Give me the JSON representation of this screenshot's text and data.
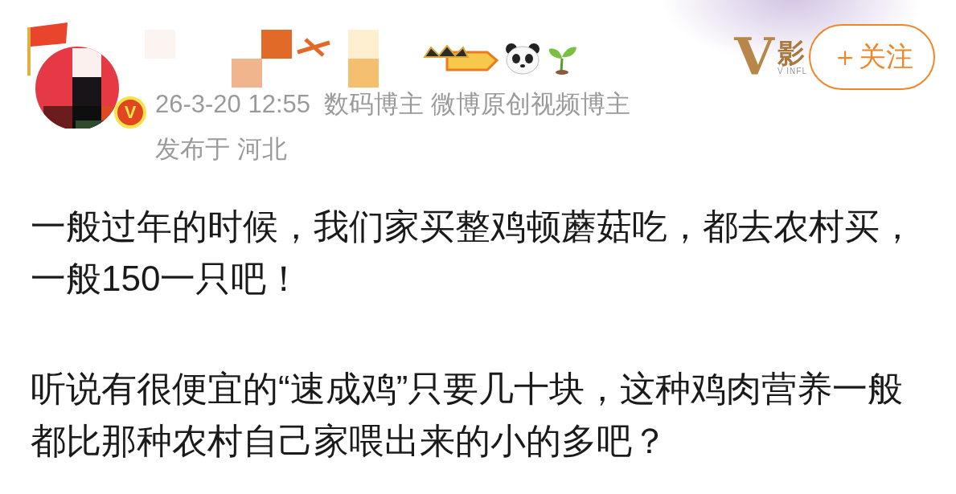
{
  "post_header": {
    "avatar_badge": "V",
    "timestamp": "26-3-20 12:55",
    "tags": "数码博主 微博原创视频博主",
    "location": "发布于 河北"
  },
  "influence_badge": {
    "letter": "V",
    "title": "影",
    "subtitle": "V INFL"
  },
  "follow_button": {
    "label": "＋关注"
  },
  "paragraphs": [
    "一般过年的时候，我们家买整鸡顿蘑菇吃，都去农村买，一般150一只吧！",
    "听说有很便宜的“速成鸡”只要几十块，这种鸡肉营养一般都比那种农村自己家喂出来的小的多吧？"
  ]
}
